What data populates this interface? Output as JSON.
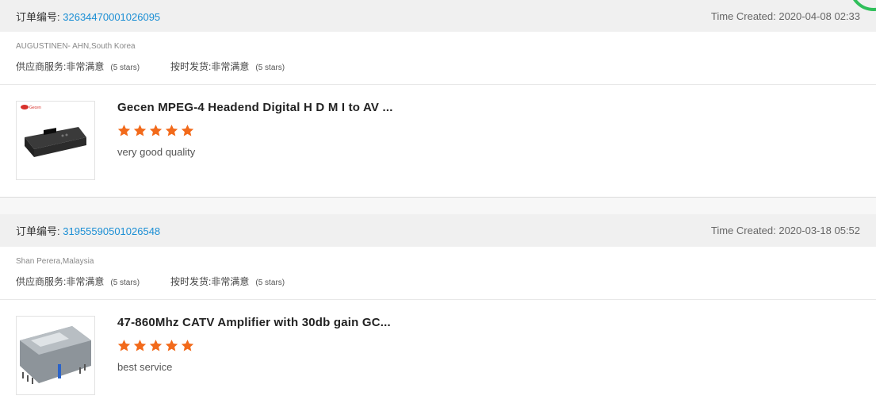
{
  "orders": [
    {
      "order_label": "订单编号:",
      "order_number": "3263447000102609​5",
      "time_created": "Time Created: 2020-04-08 02:33",
      "buyer": "AUGUSTINEN- AHN,South Korea",
      "supplier_service_label": "供应商服务:",
      "supplier_service_value": "非常满意",
      "supplier_service_stars": "(5 stars)",
      "on_time_label": "按时发货:",
      "on_time_value": "非常满意",
      "on_time_stars": "(5 stars)",
      "product_title": "Gecen MPEG-4 Headend Digital H D M I to AV ...",
      "rating": 5,
      "feedback": "very good quality",
      "thumb_logo": "Gecen"
    },
    {
      "order_label": "订单编号:",
      "order_number": "31955590501026548",
      "time_created": "Time Created: 2020-03-18 05:52",
      "buyer": "Shan Perera,Malaysia",
      "supplier_service_label": "供应商服务:",
      "supplier_service_value": "非常满意",
      "supplier_service_stars": "(5 stars)",
      "on_time_label": "按时发货:",
      "on_time_value": "非常满意",
      "on_time_stars": "(5 stars)",
      "product_title": "47-860Mhz CATV Amplifier with 30db gain GC...",
      "rating": 5,
      "feedback": "best service"
    }
  ],
  "colors": {
    "link": "#1a8ed4",
    "star": "#f26a1b",
    "header_bg": "#f0f0f0",
    "badge": "#2fbf5a"
  },
  "icons": {
    "star": "star-icon"
  }
}
